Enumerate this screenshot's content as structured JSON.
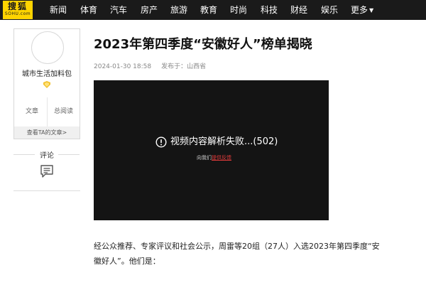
{
  "logo": {
    "main": "搜狐",
    "sub": "SOHU.com"
  },
  "nav": {
    "items": [
      "新闻",
      "体育",
      "汽车",
      "房产",
      "旅游",
      "教育",
      "时尚",
      "科技",
      "财经",
      "娱乐"
    ],
    "more": "更多"
  },
  "author": {
    "name": "城市生活加料包",
    "stats": {
      "articles_label": "文章",
      "views_label": "总阅读"
    },
    "view_articles": "查看TA的文章>"
  },
  "comment": {
    "label": "评论"
  },
  "article": {
    "title": "2023年第四季度“安徽好人”榜单揭晓",
    "date": "2024-01-30 18:58",
    "published_in": "发布于：山西省",
    "paragraph": "经公众推荐、专家评议和社会公示，周雷等20组（27人）入选2023年第四季度“安徽好人”。他们是："
  },
  "video": {
    "error": "视频内容解析失败...(502)",
    "feedback_prefix": "向我们",
    "feedback_link": "提供反馈"
  },
  "colors": {
    "nav_bg": "#1a1a1a",
    "logo_bg": "#ffd400",
    "link_red": "#e23b3b",
    "video_bg": "#141414"
  }
}
